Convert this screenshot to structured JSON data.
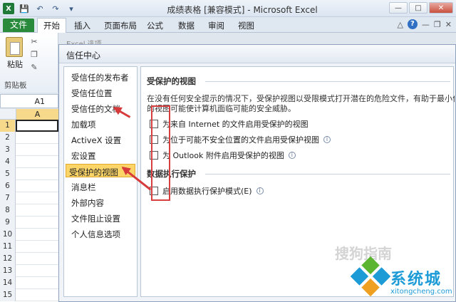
{
  "window": {
    "title": "成绩表格 [兼容模式] - Microsoft Excel",
    "qat": [
      "save-icon",
      "undo-icon",
      "redo-icon"
    ],
    "controls": [
      "minimize",
      "maximize",
      "close"
    ]
  },
  "ribbon": {
    "file_tab": "文件",
    "tabs": [
      "开始",
      "插入",
      "页面布局",
      "公式",
      "数据",
      "审阅",
      "视图"
    ],
    "active_tab": "开始",
    "paste_label": "粘贴",
    "clipboard_label": "剪贴板"
  },
  "sheet": {
    "name_box": "A1",
    "column": "A",
    "rows": [
      "1",
      "2",
      "3",
      "4",
      "5",
      "6",
      "7",
      "8",
      "9",
      "10",
      "11",
      "12",
      "13",
      "14",
      "15"
    ]
  },
  "dialog": {
    "title": "信任中心",
    "bg_title": "Excel 选项",
    "nav": [
      "受信任的发布者",
      "受信任位置",
      "受信任的文档",
      "加载项",
      "ActiveX 设置",
      "宏设置",
      "受保护的视图",
      "消息栏",
      "外部内容",
      "文件阻止设置",
      "个人信息选项"
    ],
    "active_nav": 6,
    "section1_title": "受保护的视图",
    "description_line1": "在没有任何安全提示的情况下，受保护视图以受限模式打开潜在的危险文件，有助于最小化对计算",
    "description_line2": "的视图可能使计算机面临可能的安全威胁。",
    "options": [
      "为来自 Internet 的文件启用受保护的视图",
      "为位于可能不安全位置的文件启用受保护视图",
      "为 Outlook 附件启用受保护的视图"
    ],
    "section2_title": "数据执行保护",
    "dep_option": "启用数据执行保护模式(E)"
  },
  "watermark": {
    "text": "系统城",
    "url": "xitongcheng.com",
    "faint": "搜狗指南"
  },
  "colors": {
    "accent": "#fbd568",
    "file_tab": "#2a8a3c",
    "annotation": "#d64040",
    "watermark": "#1d9bd7"
  }
}
